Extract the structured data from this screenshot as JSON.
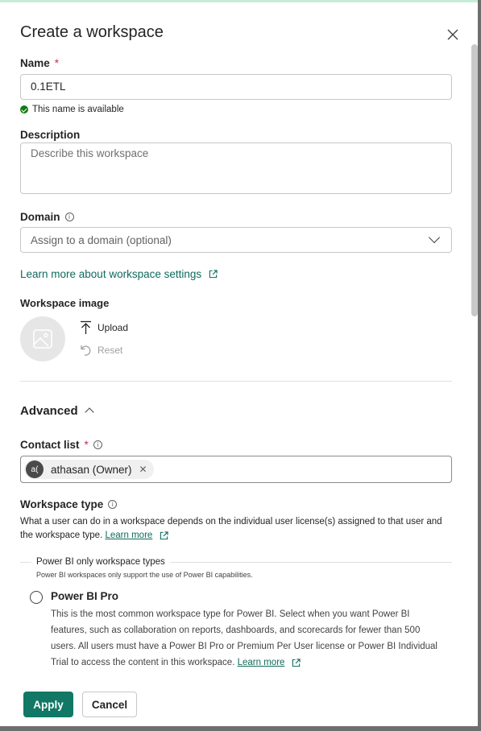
{
  "dialog": {
    "title": "Create a workspace",
    "close_icon": "close-icon"
  },
  "name": {
    "label": "Name",
    "required_mark": "*",
    "value": "0.1ETL",
    "status": "This name is available",
    "status_color": "#107c10"
  },
  "description": {
    "label": "Description",
    "placeholder": "Describe this workspace"
  },
  "domain": {
    "label": "Domain",
    "placeholder": "Assign to a domain (optional)"
  },
  "learn_more_settings": "Learn more about workspace settings",
  "workspace_image": {
    "label": "Workspace image",
    "upload": "Upload",
    "reset": "Reset"
  },
  "advanced": {
    "label": "Advanced"
  },
  "contact_list": {
    "label": "Contact list",
    "required_mark": "*",
    "chip_avatar": "a(",
    "chip_label": "athasan (Owner)"
  },
  "workspace_type": {
    "label": "Workspace type",
    "description": "What a user can do in a workspace depends on the individual user license(s) assigned to that user and the workspace type.",
    "learn_more": "Learn more",
    "group_title": "Power BI only workspace types",
    "group_subtitle": "Power BI workspaces only support the use of Power BI capabilities.",
    "options": [
      {
        "title": "Power BI Pro",
        "description": "This is the most common workspace type for Power BI. Select when you want Power BI features, such as collaboration on reports, dashboards, and scorecards for fewer than 500 users. All users must have a Power BI Pro or Premium Per User license or Power BI Individual Trial to access the content in this workspace.",
        "learn_more": "Learn more",
        "selected": false
      }
    ]
  },
  "footer": {
    "apply": "Apply",
    "cancel": "Cancel"
  },
  "colors": {
    "accent": "#117865",
    "link": "#0f6a5c",
    "required": "#c4314b"
  }
}
